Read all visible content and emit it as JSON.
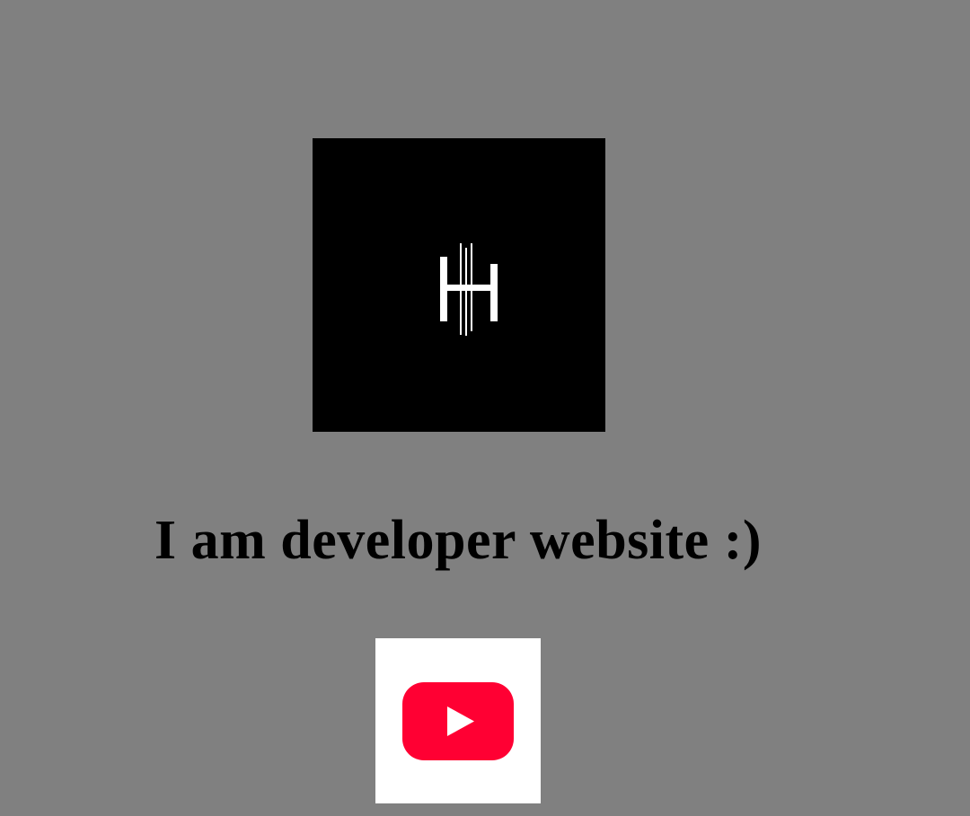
{
  "logo": {
    "icon": "hh-monogram-logo",
    "background": "#000000",
    "foreground": "#ffffff"
  },
  "headline": {
    "text": "I am developer website :)"
  },
  "youtube_link": {
    "icon": "youtube-icon",
    "tile_color": "#ffffff",
    "brand_color": "#ff0033"
  },
  "colors": {
    "page_background": "#808080",
    "text": "#000000"
  }
}
